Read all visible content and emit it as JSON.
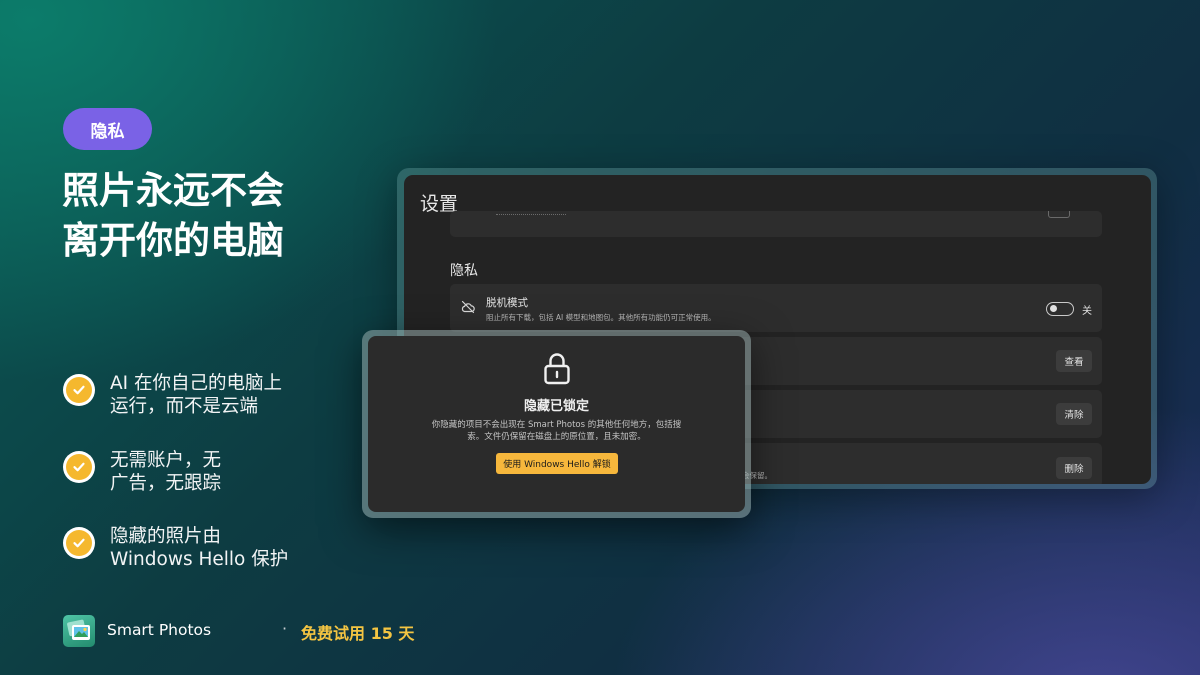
{
  "badge": {
    "label": "隐私",
    "color": "#7a62e6"
  },
  "headline": {
    "line1": "照片永远不会",
    "line2": "离开你的电脑"
  },
  "features": [
    {
      "line1": "AI 在你自己的电脑上",
      "line2": "运行，而不是云端",
      "icon": "check-circle-icon"
    },
    {
      "line1": "无需账户，无",
      "line2": "广告，无跟踪",
      "icon": "check-circle-icon"
    },
    {
      "line1": "隐藏的照片由",
      "line2": "Windows Hello 保护",
      "icon": "check-circle-icon"
    }
  ],
  "footer": {
    "app_name": "Smart Photos",
    "separator": "·",
    "trial": "免费试用 15 天",
    "trial_color": "#f4c542"
  },
  "settings": {
    "title": "设置",
    "section_label": "隐私",
    "offline": {
      "title": "脱机模式",
      "description": "阻止所有下载，包括 AI 模型和地图包。其他所有功能仍可正常使用。",
      "toggle_state": "关",
      "icon": "cloud-off-icon"
    },
    "view_button": "查看",
    "clear_button": "清除",
    "delete_button": "删除",
    "delete_tail": "会保留。"
  },
  "dialog": {
    "title": "隐藏已锁定",
    "description_line1": "你隐藏的项目不会出现在 Smart Photos 的其他任何地方，包括搜",
    "description_line2": "索。文件仍保留在磁盘上的原位置，且未加密。",
    "unlock_button": "使用 Windows Hello 解锁",
    "unlock_color": "#f6b73c",
    "icon": "lock-icon"
  }
}
